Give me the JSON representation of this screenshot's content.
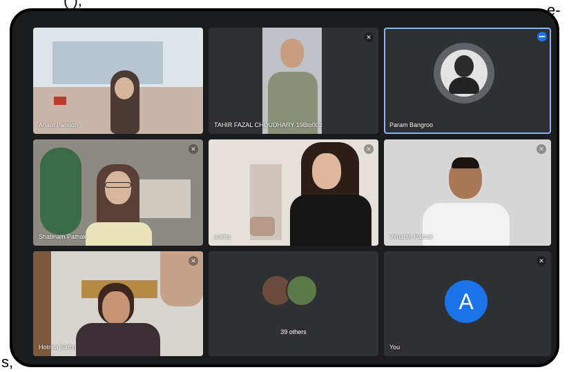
{
  "document": {
    "top_fragment": "(                ),",
    "right_fragment": "e-",
    "bottom_fragment": "s,"
  },
  "participants": [
    {
      "name": "Anam Pandoh"
    },
    {
      "name": "TAHIR FAZAL CHOUDHARY 19Bio002"
    },
    {
      "name": "Param Bangroo"
    },
    {
      "name": "Shabnam Pathak"
    },
    {
      "name": "ankita"
    },
    {
      "name": "Vimarsh Pathak"
    },
    {
      "name": "Hotrika Sathu"
    },
    {
      "name": "39 others"
    },
    {
      "name": "You",
      "initial": "A"
    }
  ],
  "colors": {
    "you_avatar": "#1a73e8",
    "active_border": "#8ab4f8"
  }
}
